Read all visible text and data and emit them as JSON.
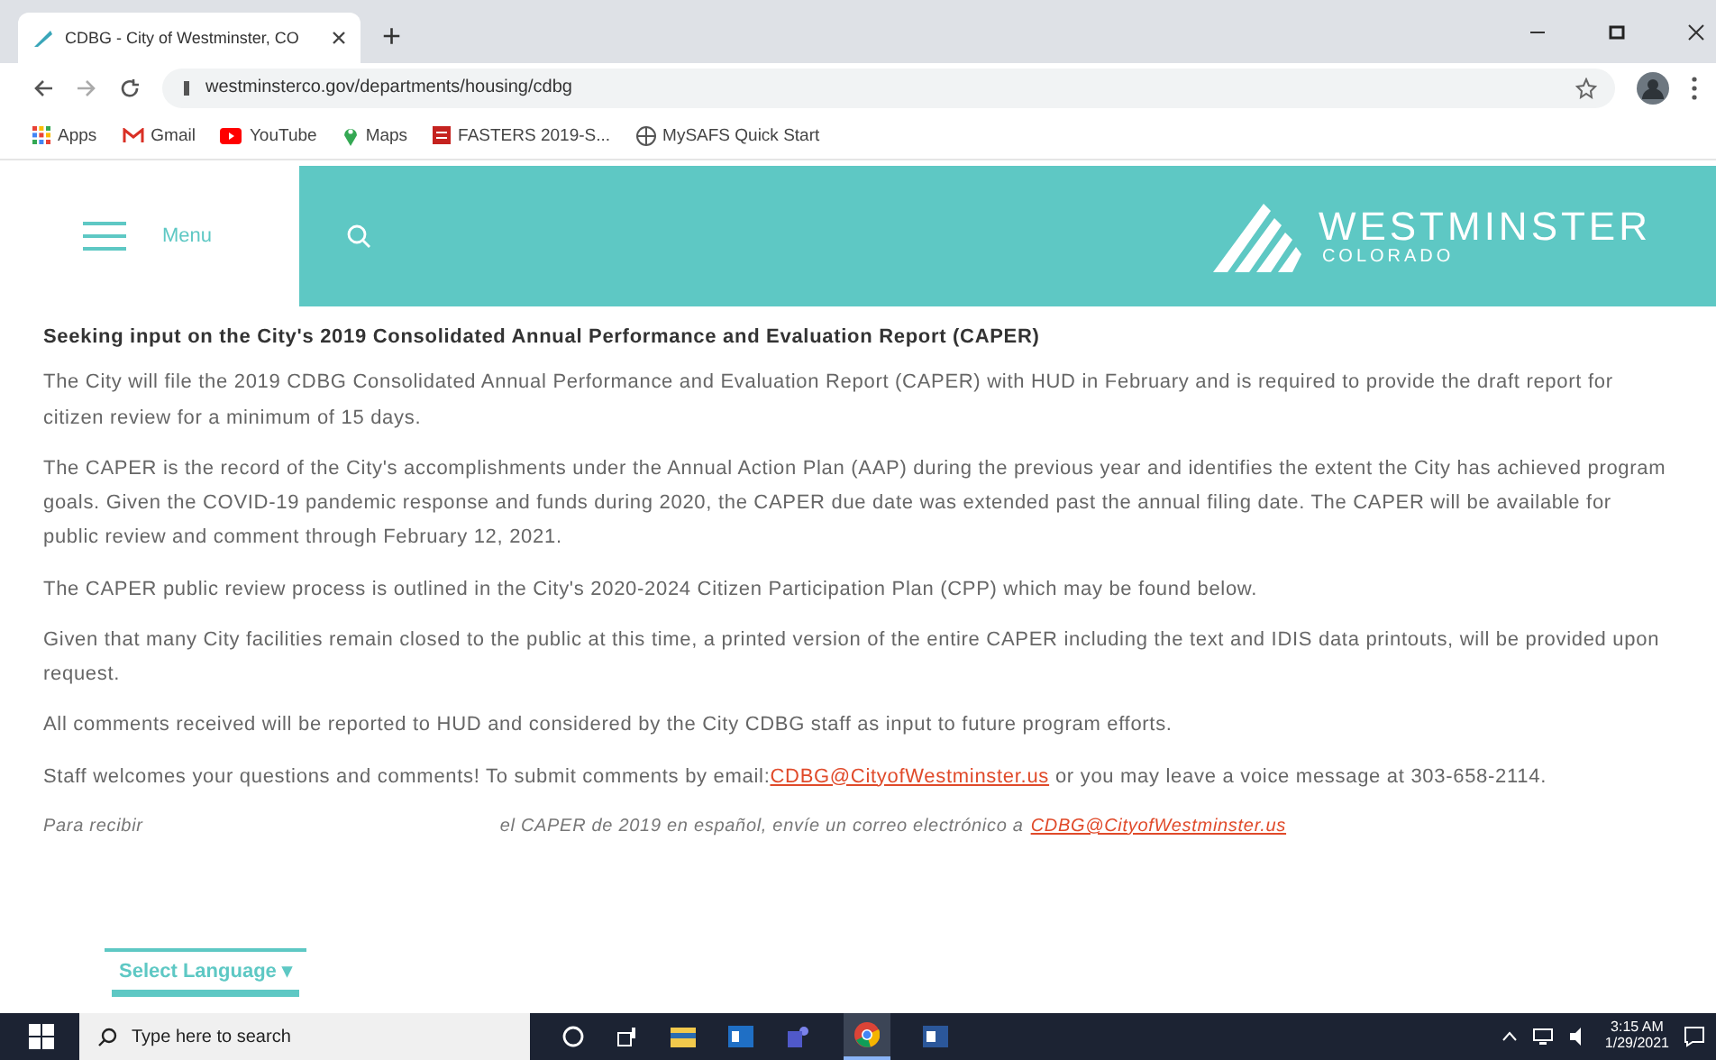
{
  "browser": {
    "tab_title": "CDBG - City of Westminster, CO",
    "new_tab": "+",
    "url": "westminsterco.gov/departments/housing/cdbg",
    "bookmarks": [
      {
        "kind": "apps",
        "label": "Apps"
      },
      {
        "kind": "mail",
        "label": "Gmail"
      },
      {
        "kind": "video",
        "label": "YouTube"
      },
      {
        "kind": "pin",
        "label": "Maps"
      },
      {
        "kind": "doc",
        "label": "FASTERS 2019-S..."
      },
      {
        "kind": "globe",
        "label": "MySAFS Quick Start"
      }
    ]
  },
  "site_header": {
    "menu_label": "Menu",
    "logo_name": "WESTMINSTER",
    "logo_sub": "COLORADO"
  },
  "article": {
    "title": "Seeking input on the City's 2019 Consolidated Annual Performance and Evaluation Report (CAPER)",
    "paragraphs": [
      {
        "text": "The City will file the 2019 CDBG Consolidated Annual Performance and Evaluation Report (CAPER) with HUD in February and is required to provide the draft report for citizen review for a minimum of 15 days."
      },
      {
        "text": "The CAPER is the record of the City's accomplishments under the Annual Action Plan (AAP) during the previous year and identifies the extent the City has achieved program goals. Given the COVID-19 pandemic response and funds during 2020, the CAPER due date was extended past the annual filing date. The CAPER will be available for public review and comment through February 12, 2021."
      },
      {
        "text": "The CAPER public review process is outlined in the City's 2020-2024 Citizen Participation Plan (CPP) which may be found below."
      },
      {
        "text": "Given that many City facilities remain closed to the public at this time, a printed version of the entire CAPER including the text and IDIS data printouts, will be provided upon request."
      },
      {
        "text": "All comments received will be reported to HUD and considered by the City CDBG staff as input to future program efforts."
      },
      {
        "text": "Staff welcomes your questions and comments! To submit comments by email:",
        "link": "CDBG@CityofWestminster.us",
        "after": "or you may leave a voice message at 303-658-2114."
      }
    ],
    "spanish_start": "Para recibir",
    "spanish_rest": "el CAPER de 2019 en español, envíe un correo electrónico a",
    "spanish_link": "CDBG@CityofWestminster.us"
  },
  "language_widget": {
    "label": "Select Language",
    "caret": "▾"
  },
  "taskbar": {
    "search_placeholder": "Type here to search",
    "time": "3:15 AM",
    "date": "1/29/2021"
  }
}
